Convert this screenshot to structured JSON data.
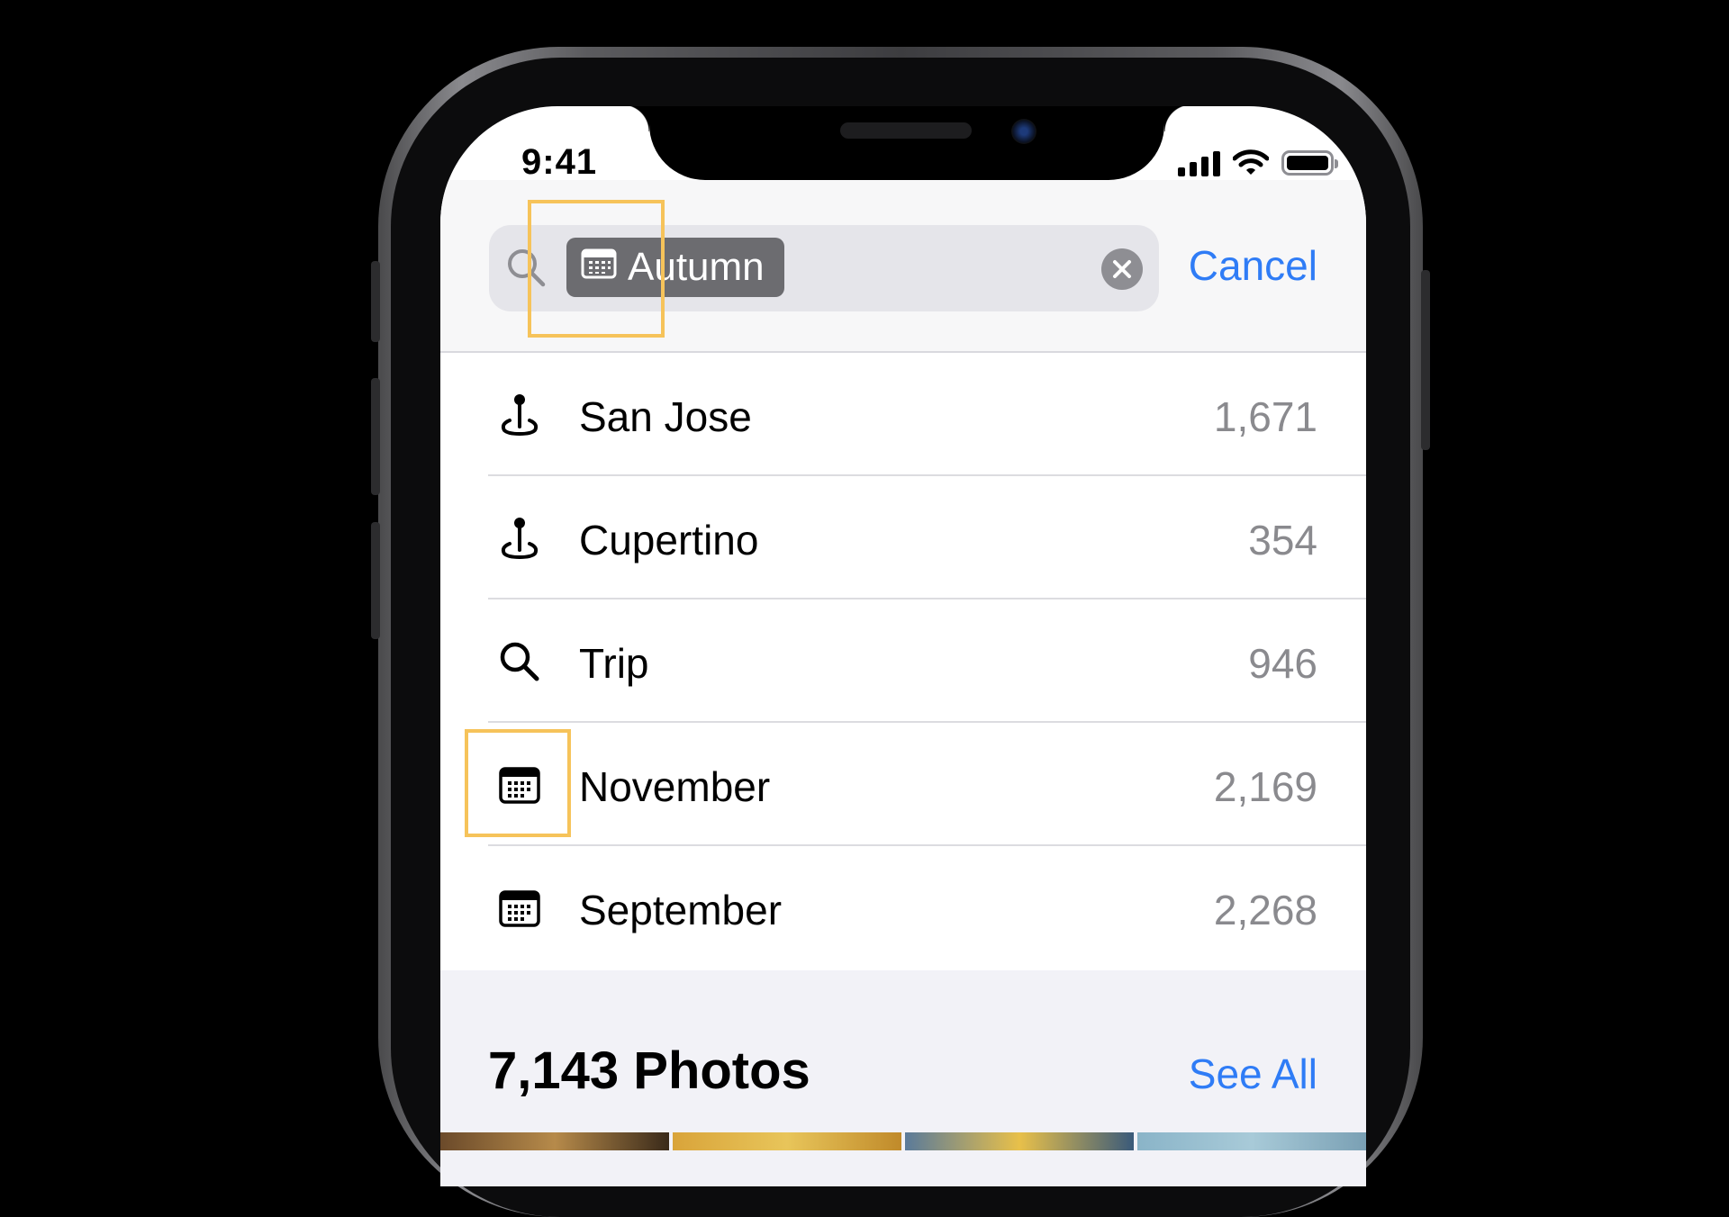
{
  "status_bar": {
    "time": "9:41"
  },
  "search": {
    "token_label": "Autumn",
    "token_icon": "calendar-icon",
    "cancel_label": "Cancel"
  },
  "suggestions": [
    {
      "icon": "map-pin-icon",
      "label": "San Jose",
      "count": "1,671"
    },
    {
      "icon": "map-pin-icon",
      "label": "Cupertino",
      "count": "354"
    },
    {
      "icon": "magnifier-icon",
      "label": "Trip",
      "count": "946"
    },
    {
      "icon": "calendar-icon",
      "label": "November",
      "count": "2,169"
    },
    {
      "icon": "calendar-icon",
      "label": "September",
      "count": "2,268"
    }
  ],
  "photos": {
    "title": "7,143 Photos",
    "see_all_label": "See All"
  },
  "colors": {
    "accent": "#2f7cf6",
    "highlight": "#f6c35a",
    "token_bg": "#6c6c70"
  }
}
